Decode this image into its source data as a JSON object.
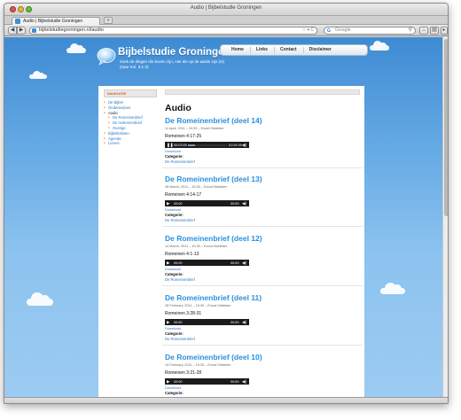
{
  "window": {
    "title": "Audio | Bijbelstudie Groningen",
    "tab_label": "Audio | Bijbelstudie Groningen",
    "tab_add": "+",
    "url": "bijbelstudiegroningen.nl/audio",
    "url_icons": "☆ ▾ C",
    "search_placeholder": "Google",
    "search_engine_glyph": "G"
  },
  "site": {
    "title": "Bijbelstudie Groningen",
    "tagline": "Zoek de dingen die boven zijn, niet die op de aarde zijn (nl) (naar Kol. 3:1-2)",
    "topnav": [
      "Home",
      "Links",
      "Contact",
      "Disclaimer"
    ]
  },
  "sidebar": {
    "heading": "NAVIGATIE",
    "items": [
      {
        "label": "De Bijbel",
        "level": 1
      },
      {
        "label": "Onderwerpen",
        "level": 1
      },
      {
        "label": "Audio",
        "level": 1,
        "active": true
      },
      {
        "label": "De Romeinenbrief",
        "level": 2
      },
      {
        "label": "De Hebreeënbrief",
        "level": 2
      },
      {
        "label": "Overige",
        "level": 2
      },
      {
        "label": "Bijbelteksten",
        "level": 1
      },
      {
        "label": "Agenda",
        "level": 1
      },
      {
        "label": "Lezers",
        "level": 1
      }
    ]
  },
  "content": {
    "heading": "Audio",
    "download_label": "Download",
    "category_label": "Categorie:",
    "posts": [
      {
        "title": "De Romeinenbrief (deel 14)",
        "meta": "11 April, 2011 – 19:30 – Evout Hiddeker",
        "reference": "Romeinen 4:17-25",
        "player_time": "00:03:59",
        "player_duration": "01:04:39",
        "progress": 0.18,
        "playing": true,
        "category": "De Romeinenbrief"
      },
      {
        "title": "De Romeinenbrief (deel 13)",
        "meta": "28 March, 2011 – 19:30 – Evout Hiddeker",
        "reference": "Romeinen 4:14-17",
        "player_time": "00:00",
        "player_duration": "00:00",
        "progress": 0,
        "playing": false,
        "category": "De Romeinenbrief"
      },
      {
        "title": "De Romeinenbrief (deel 12)",
        "meta": "14 March, 2011 – 19:30 – Evout Hiddeker",
        "reference": "Romeinen 4:1-13",
        "player_time": "00:00",
        "player_duration": "00:00",
        "progress": 0,
        "playing": false,
        "category": "De Romeinenbrief"
      },
      {
        "title": "De Romeinenbrief (deel 11)",
        "meta": "28 February, 2011 – 19:30 – Evout Hiddeker",
        "reference": "Romeinen 3:28-31",
        "player_time": "00:00",
        "player_duration": "00:00",
        "progress": 0,
        "playing": false,
        "category": "De Romeinenbrief"
      },
      {
        "title": "De Romeinenbrief (deel 10)",
        "meta": "14 February, 2011 – 19:30 – Evout Hiddeker",
        "reference": "Romeinen 3:21-28",
        "player_time": "00:00",
        "player_duration": "00:00",
        "progress": 0,
        "playing": false,
        "category": ""
      }
    ]
  },
  "colors": {
    "sky_top": "#3e8bd3",
    "link_blue": "#2a8fde",
    "accent_orange": "#e05a2a",
    "player_bg": "#1b1b1b"
  }
}
